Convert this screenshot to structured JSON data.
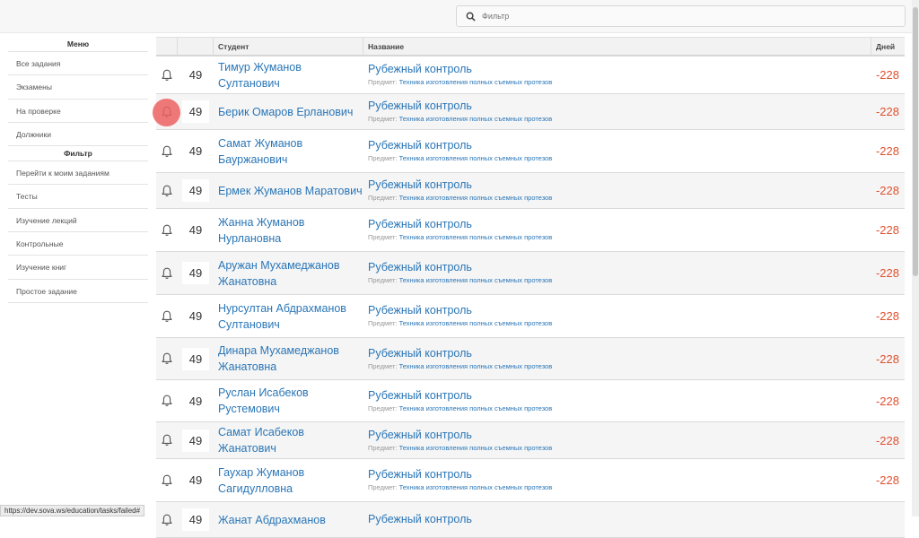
{
  "search": {
    "placeholder": "Фильтр"
  },
  "sidebar": {
    "menu_title": "Меню",
    "menu_items": [
      "Все задания",
      "Экзамены",
      "На проверке",
      "Должники"
    ],
    "filter_title": "Фильтр",
    "filter_items": [
      "Перейти к моим заданиям",
      "Тесты",
      "Изучение лекций",
      "Контрольные",
      "Изучение книг",
      "Простое задание"
    ]
  },
  "table": {
    "headers": [
      "",
      "",
      "Студент",
      "Название",
      "Дней"
    ],
    "subject_prefix": "Предмет:",
    "rows": [
      {
        "count": "49",
        "student": "Тимур Жуманов Султанович",
        "title": "Рубежный контроль",
        "subject": "Техника изготовления полных съемных протезов",
        "days": "-228"
      },
      {
        "count": "49",
        "student": "Берик Омаров Ерланович",
        "title": "Рубежный контроль",
        "subject": "Техника изготовления полных съемных протезов",
        "days": "-228"
      },
      {
        "count": "49",
        "student": "Самат Жуманов Бауржанович",
        "title": "Рубежный контроль",
        "subject": "Техника изготовления полных съемных протезов",
        "days": "-228"
      },
      {
        "count": "49",
        "student": "Ермек Жуманов Маратович",
        "title": "Рубежный контроль",
        "subject": "Техника изготовления полных съемных протезов",
        "days": "-228"
      },
      {
        "count": "49",
        "student": "Жанна Жуманов Нурлановна",
        "title": "Рубежный контроль",
        "subject": "Техника изготовления полных съемных протезов",
        "days": "-228"
      },
      {
        "count": "49",
        "student": "Аружан Мухамеджанов Жанатовна",
        "title": "Рубежный контроль",
        "subject": "Техника изготовления полных съемных протезов",
        "days": "-228"
      },
      {
        "count": "49",
        "student": "Нурсултан Абдрахманов Султанович",
        "title": "Рубежный контроль",
        "subject": "Техника изготовления полных съемных протезов",
        "days": "-228"
      },
      {
        "count": "49",
        "student": "Динара Мухамеджанов Жанатовна",
        "title": "Рубежный контроль",
        "subject": "Техника изготовления полных съемных протезов",
        "days": "-228"
      },
      {
        "count": "49",
        "student": "Руслан Исабеков Рустемович",
        "title": "Рубежный контроль",
        "subject": "Техника изготовления полных съемных протезов",
        "days": "-228"
      },
      {
        "count": "49",
        "student": "Самат Исабеков Жанатович",
        "title": "Рубежный контроль",
        "subject": "Техника изготовления полных съемных протезов",
        "days": "-228"
      },
      {
        "count": "49",
        "student": "Гаухар Жуманов Сагидулловна",
        "title": "Рубежный контроль",
        "subject": "Техника изготовления полных съемных протезов",
        "days": "-228"
      },
      {
        "count": "49",
        "student": "Жанат Абдрахманов",
        "title": "Рубежный контроль",
        "subject": "",
        "days": ""
      }
    ]
  },
  "status_bar": {
    "url": "https://dev.sova.ws/education/tasks/failed#"
  },
  "colors": {
    "link": "#2a76b7",
    "days": "#e0502f",
    "cursor": "#ec6262"
  }
}
